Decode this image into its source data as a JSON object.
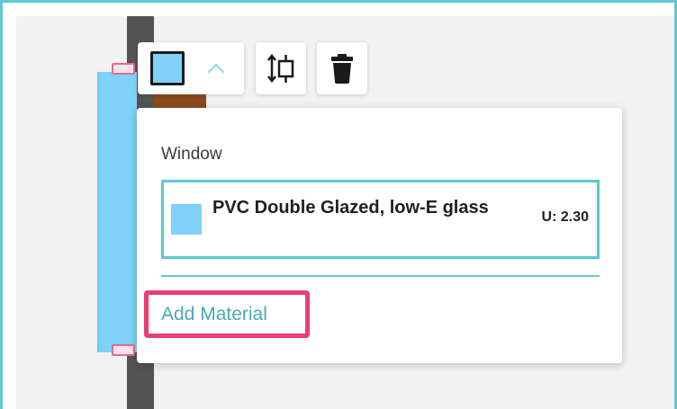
{
  "toolbar": {
    "material_swatch_color": "#7fd1f7",
    "chevron_icon": "chevron-up-icon",
    "resize_icon": "resize-height-icon",
    "delete_icon": "trash-icon"
  },
  "popup": {
    "section_title": "Window",
    "materials": [
      {
        "name": "PVC Double Glazed, low-E glass",
        "u_value": "U: 2.30",
        "color": "#7fd1f7"
      }
    ],
    "add_material_label": "Add Material"
  },
  "colors": {
    "accent": "#5ec9d2",
    "highlight": "#ea3e72",
    "link": "#4aa9b5",
    "glass": "#7fd1f7"
  }
}
